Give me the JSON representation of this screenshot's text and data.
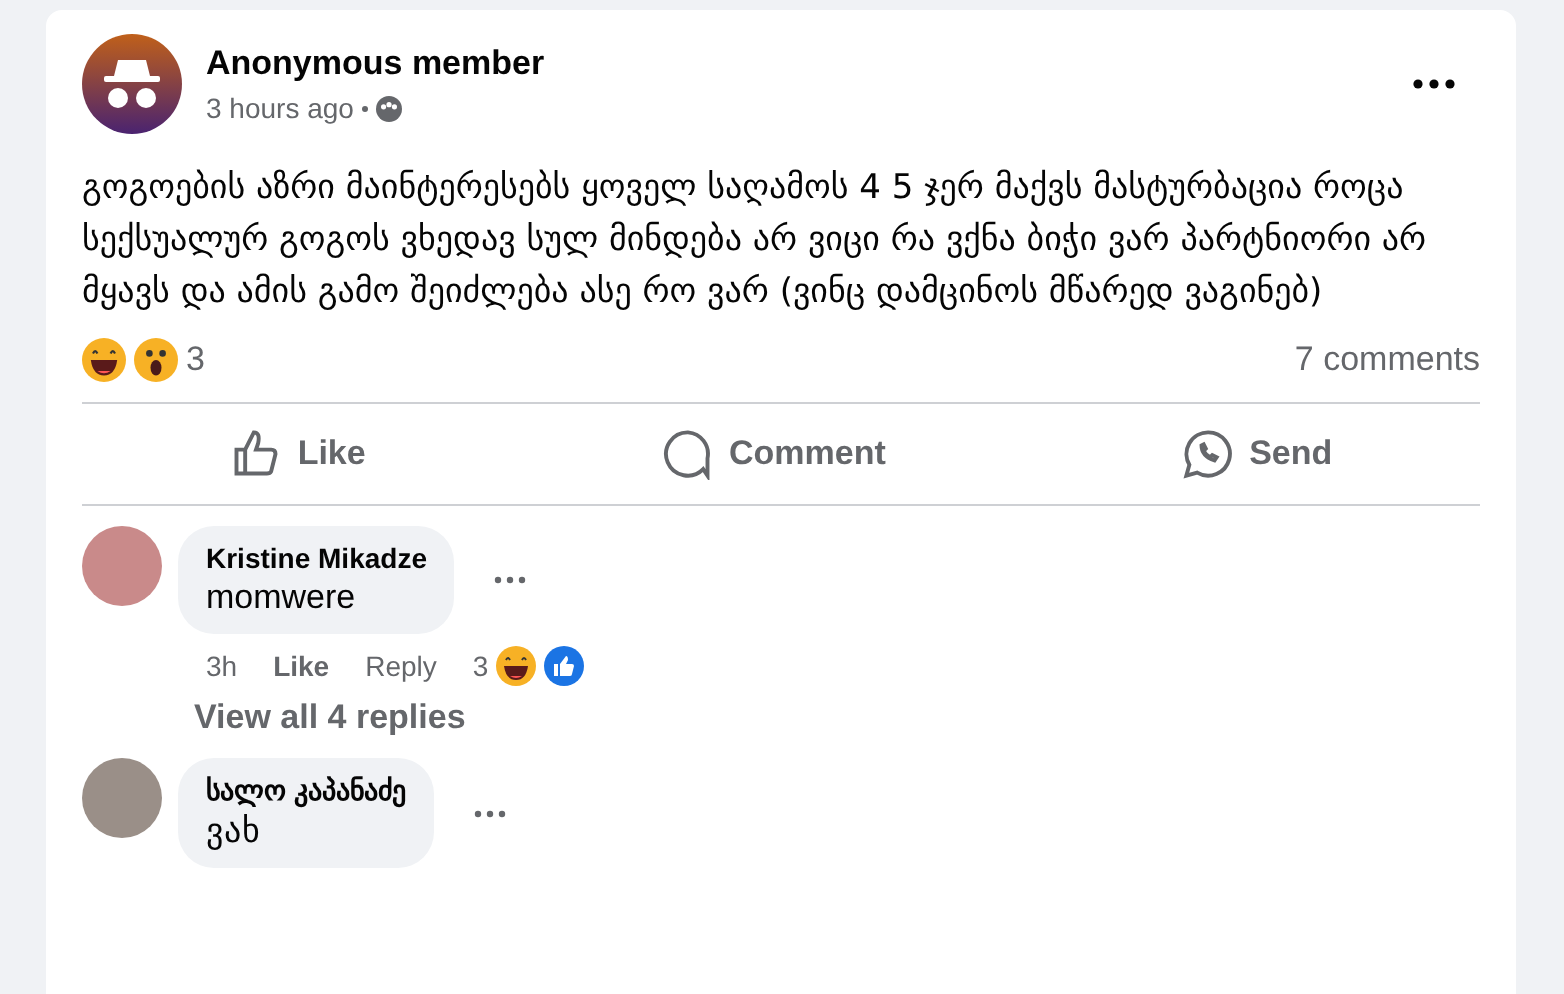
{
  "post": {
    "author": "Anonymous member",
    "time": "3 hours ago",
    "text": "გოგოების აზრი მაინტერესებს ყოველ საღამოს 4 5 ჯერ მაქვს მასტურბაცია როცა სექსუალურ გოგოს ვხედავ სულ მინდება არ ვიცი რა ვქნა ბიჭი ვარ პარტნიორი არ მყავს და ამის გამო შეიძლება ასე რო ვარ (ვინც დამცინოს მწარედ ვაგინებ)",
    "reaction_count": "3",
    "comment_count": "7 comments"
  },
  "actions": [
    {
      "kind": "like",
      "label": "Like"
    },
    {
      "kind": "comment",
      "label": "Comment"
    },
    {
      "kind": "send",
      "label": "Send"
    }
  ],
  "comments": [
    {
      "author": "Kristine Mikadze",
      "text": "momwere",
      "time": "3h",
      "like": "Like",
      "reply": "Reply",
      "reaction_count": "3",
      "replies_link": "View all 4 replies"
    },
    {
      "author": "სალო კაპანაძე",
      "text": "ვახ"
    }
  ]
}
